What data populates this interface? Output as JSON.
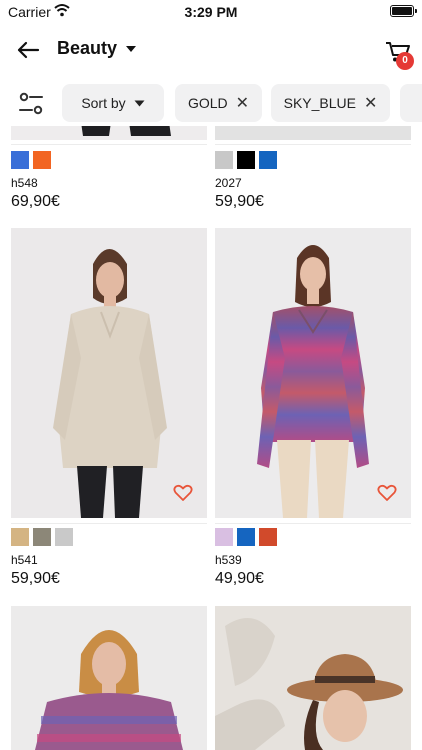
{
  "status_bar": {
    "carrier": "Carrier",
    "time": "3:29 PM"
  },
  "header": {
    "title": "Beauty",
    "cart_count": "0"
  },
  "filters": {
    "sort_label": "Sort by",
    "chips": [
      {
        "label": "GOLD"
      },
      {
        "label": "SKY_BLUE"
      }
    ]
  },
  "products": [
    {
      "name": "h548",
      "price": "69,90€",
      "swatches": [
        "#3a6fd8",
        "#f26522"
      ]
    },
    {
      "name": "2027",
      "price": "59,90€",
      "swatches": [
        "#c8c8c8",
        "#000000",
        "#1565c0"
      ]
    },
    {
      "name": "h541",
      "price": "59,90€",
      "swatches": [
        "#d4b483",
        "#8c8778",
        "#c9c9c9"
      ]
    },
    {
      "name": "h539",
      "price": "49,90€",
      "swatches": [
        "#d9bfe2",
        "#1565c0",
        "#d14a2b"
      ]
    }
  ],
  "colors": {
    "badge": "#e53935",
    "heart": "#e8553a",
    "chip_bg": "#f1f1f2"
  }
}
